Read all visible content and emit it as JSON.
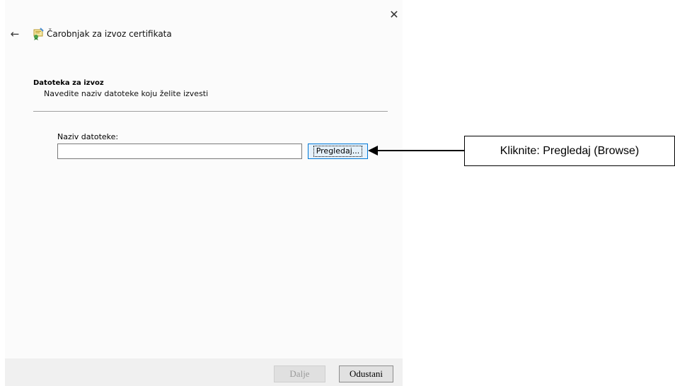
{
  "window": {
    "close_glyph": "✕",
    "back_glyph": "←",
    "title": "Čarobnjak za izvoz certifikata"
  },
  "section": {
    "title": "Datoteka za izvoz",
    "description": "Navedite naziv datoteke koju želite izvesti"
  },
  "form": {
    "file_label": "Naziv datoteke:",
    "file_value": "",
    "browse_label": "Pregledaj..."
  },
  "footer": {
    "next_label": "Dalje",
    "cancel_label": "Odustani"
  },
  "annotation": {
    "callout_text": "Kliknite: Pregledaj (Browse)"
  },
  "colors": {
    "focus_border": "#0078d7",
    "dialog_bg": "#fbfbfb",
    "footer_bg": "#f0f0f0"
  }
}
